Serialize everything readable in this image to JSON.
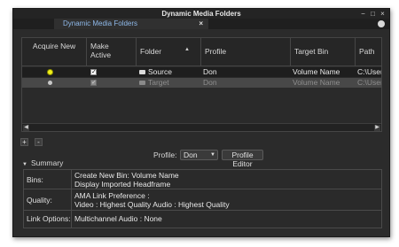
{
  "window": {
    "title": "Dynamic Media Folders",
    "controls": {
      "minimize": "−",
      "maximize": "□",
      "close": "×"
    }
  },
  "tab": {
    "label": "Dynamic Media Folders",
    "close": "×",
    "menu_icon": "circle-menu-icon"
  },
  "table": {
    "columns": [
      {
        "label": "Acquire New"
      },
      {
        "label": "Make Active"
      },
      {
        "label": "Folder",
        "sort_indicator": "▲"
      },
      {
        "label": "Profile"
      },
      {
        "label": "Target Bin"
      },
      {
        "label": "Path"
      }
    ],
    "rows": [
      {
        "acquire": "selected",
        "make_active": true,
        "folder": "Source",
        "profile": "Don",
        "target_bin": "Volume Name",
        "path": "C:\\Users\\",
        "state": "normal"
      },
      {
        "acquire": "unselected",
        "make_active": true,
        "folder": "Target",
        "profile": "Don",
        "target_bin": "Volume Name",
        "path": "C:\\Users\\",
        "state": "disabled"
      }
    ]
  },
  "buttons": {
    "add": "+",
    "remove": "-"
  },
  "profile": {
    "label": "Profile:",
    "value": "Don",
    "editor_label": "Profile Editor"
  },
  "summary": {
    "title": "Summary",
    "rows": [
      {
        "label": "Bins:",
        "lines": [
          "Create New Bin: Volume Name",
          "Display Imported Headframe"
        ]
      },
      {
        "label": "Quality:",
        "lines": [
          "AMA Link  Preference :",
          "Video : Highest Quality     Audio : Highest Quality"
        ]
      },
      {
        "label": "Link Options:",
        "lines": [
          "Multichannel Audio : None"
        ]
      }
    ]
  },
  "colors": {
    "panel_bg": "#2b2b2b",
    "tab_text": "#8eb8e8",
    "radio_selected": "#f0f01a",
    "selected_row_bg": "#484848"
  }
}
